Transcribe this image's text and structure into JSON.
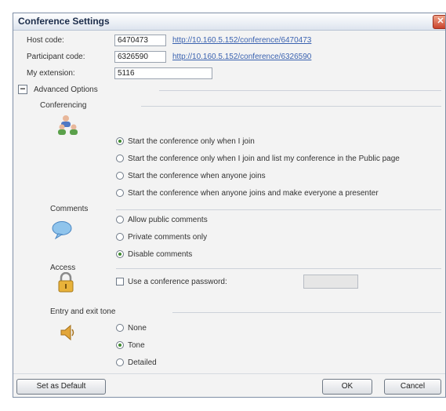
{
  "window": {
    "title": "Conference Settings",
    "close_glyph": "✕"
  },
  "codes": {
    "host_label": "Host code:",
    "host_value": "6470473",
    "host_link": "http://10.160.5.152/conference/6470473",
    "participant_label": "Participant code:",
    "participant_value": "6326590",
    "participant_link": "http://10.160.5.152/conference/6326590",
    "extension_label": "My extension:",
    "extension_value": "5116"
  },
  "advanced": {
    "toggle_glyph": "−",
    "label": "Advanced Options"
  },
  "conferencing": {
    "heading": "Conferencing",
    "icon": "people-icon",
    "options": [
      "Start the conference only when I join",
      "Start the conference only when I join and list my conference in the Public page",
      "Start the conference when anyone joins",
      "Start the conference when anyone joins and make everyone a presenter"
    ],
    "selected": 0
  },
  "comments": {
    "heading": "Comments",
    "icon": "speech-bubble-icon",
    "options": [
      "Allow public comments",
      "Private comments only",
      "Disable comments"
    ],
    "selected": 2
  },
  "access": {
    "heading": "Access",
    "icon": "padlock-icon",
    "password_label": "Use a conference password:",
    "password_checked": false,
    "password_value": ""
  },
  "entry_exit": {
    "heading": "Entry and exit tone",
    "icon": "speaker-icon",
    "options": [
      "None",
      "Tone",
      "Detailed"
    ],
    "selected": 1
  },
  "buttons": {
    "set_default": "Set as Default",
    "ok": "OK",
    "cancel": "Cancel"
  },
  "colors": {
    "accent": "#3a62b0",
    "selected_radio": "#3f8a2f",
    "close": "#c9432b"
  }
}
